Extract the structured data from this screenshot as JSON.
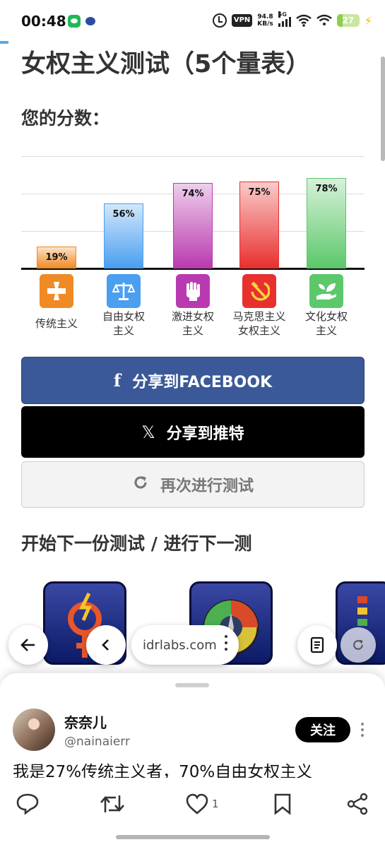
{
  "status_bar": {
    "time": "00:48",
    "vpn": "VPN",
    "speed_value": "94.8",
    "speed_unit": "KB/s",
    "network": "5G",
    "battery": "27",
    "battery_level": 0.27
  },
  "page": {
    "title": "女权主义测试（5个量表）",
    "score_heading": "您的分数："
  },
  "chart_data": {
    "type": "bar",
    "categories": [
      "传统主义",
      "自由女权主义",
      "激进女权主义",
      "马克思主义女权主义",
      "文化女权主义"
    ],
    "category_lines": [
      [
        "传统主义"
      ],
      [
        "自由女权",
        "主义"
      ],
      [
        "激进女权",
        "主义"
      ],
      [
        "马克思主义",
        "女权主义"
      ],
      [
        "文化女权",
        "主义"
      ]
    ],
    "values": [
      19,
      56,
      74,
      75,
      78
    ],
    "value_labels": [
      "19%",
      "56%",
      "74%",
      "75%",
      "78%"
    ],
    "ylim": [
      0,
      100
    ],
    "grid": true,
    "colors": [
      "#f08a24",
      "#4a9ff0",
      "#b93ab0",
      "#e8302e",
      "#5cc86a"
    ],
    "icons": [
      "cross-icon",
      "scales-icon",
      "fist-icon",
      "hammer-sickle-icon",
      "hand-leaf-icon"
    ]
  },
  "buttons": {
    "facebook": "分享到FACEBOOK",
    "twitter": "分享到推特",
    "retake": "再次进行测试"
  },
  "next_heading": "开始下一份测试 / 进行下一测",
  "browser": {
    "url": "idrlabs.com"
  },
  "sheet": {
    "username": "奈奈儿",
    "handle": "@nainaierr",
    "follow": "关注",
    "tweet": "我是27%传统主义者，70%自由女权主义",
    "like_count": "1"
  }
}
